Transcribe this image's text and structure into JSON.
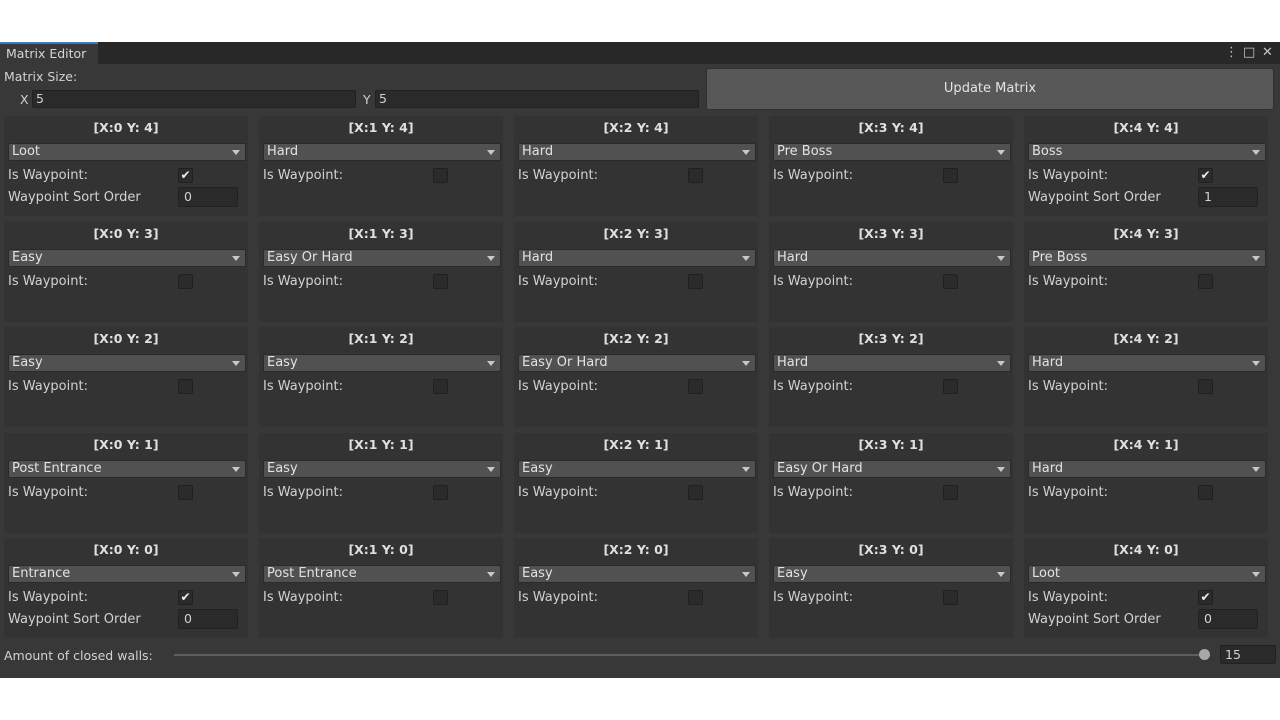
{
  "window": {
    "tab_title": "Matrix Editor",
    "controls": {
      "menu_icon": "⋮",
      "maximize_icon": "□",
      "close_icon": "✕"
    }
  },
  "matrix_size": {
    "label": "Matrix Size:",
    "x_label": "X",
    "x_value": "5",
    "y_label": "Y",
    "y_value": "5"
  },
  "update_button": "Update Matrix",
  "labels": {
    "is_waypoint": "Is Waypoint:",
    "waypoint_sort_order": "Waypoint Sort Order"
  },
  "rows": [
    [
      {
        "title": "[X:0 Y: 4]",
        "type": "Loot",
        "waypoint": true,
        "order": "0"
      },
      {
        "title": "[X:1 Y: 4]",
        "type": "Hard",
        "waypoint": false
      },
      {
        "title": "[X:2 Y: 4]",
        "type": "Hard",
        "waypoint": false
      },
      {
        "title": "[X:3 Y: 4]",
        "type": "Pre Boss",
        "waypoint": false
      },
      {
        "title": "[X:4 Y: 4]",
        "type": "Boss",
        "waypoint": true,
        "order": "1"
      }
    ],
    [
      {
        "title": "[X:0 Y: 3]",
        "type": "Easy",
        "waypoint": false
      },
      {
        "title": "[X:1 Y: 3]",
        "type": "Easy Or Hard",
        "waypoint": false
      },
      {
        "title": "[X:2 Y: 3]",
        "type": "Hard",
        "waypoint": false
      },
      {
        "title": "[X:3 Y: 3]",
        "type": "Hard",
        "waypoint": false
      },
      {
        "title": "[X:4 Y: 3]",
        "type": "Pre Boss",
        "waypoint": false
      }
    ],
    [
      {
        "title": "[X:0 Y: 2]",
        "type": "Easy",
        "waypoint": false
      },
      {
        "title": "[X:1 Y: 2]",
        "type": "Easy",
        "waypoint": false
      },
      {
        "title": "[X:2 Y: 2]",
        "type": "Easy Or Hard",
        "waypoint": false
      },
      {
        "title": "[X:3 Y: 2]",
        "type": "Hard",
        "waypoint": false
      },
      {
        "title": "[X:4 Y: 2]",
        "type": "Hard",
        "waypoint": false
      }
    ],
    [
      {
        "title": "[X:0 Y: 1]",
        "type": "Post Entrance",
        "waypoint": false
      },
      {
        "title": "[X:1 Y: 1]",
        "type": "Easy",
        "waypoint": false
      },
      {
        "title": "[X:2 Y: 1]",
        "type": "Easy",
        "waypoint": false
      },
      {
        "title": "[X:3 Y: 1]",
        "type": "Easy Or Hard",
        "waypoint": false
      },
      {
        "title": "[X:4 Y: 1]",
        "type": "Hard",
        "waypoint": false
      }
    ],
    [
      {
        "title": "[X:0 Y: 0]",
        "type": "Entrance",
        "waypoint": true,
        "order": "0"
      },
      {
        "title": "[X:1 Y: 0]",
        "type": "Post Entrance",
        "waypoint": false
      },
      {
        "title": "[X:2 Y: 0]",
        "type": "Easy",
        "waypoint": false
      },
      {
        "title": "[X:3 Y: 0]",
        "type": "Easy",
        "waypoint": false
      },
      {
        "title": "[X:4 Y: 0]",
        "type": "Loot",
        "waypoint": true,
        "order": "0"
      }
    ]
  ],
  "closed_walls": {
    "label": "Amount of closed walls:",
    "value": "15",
    "fraction": 0.995
  },
  "icons": {
    "checkmark": "✔",
    "dropdown": "chevron-down-icon"
  },
  "colors": {
    "accent": "#3a79bb",
    "background": "#383838",
    "cell": "#333333",
    "button": "#585858"
  }
}
